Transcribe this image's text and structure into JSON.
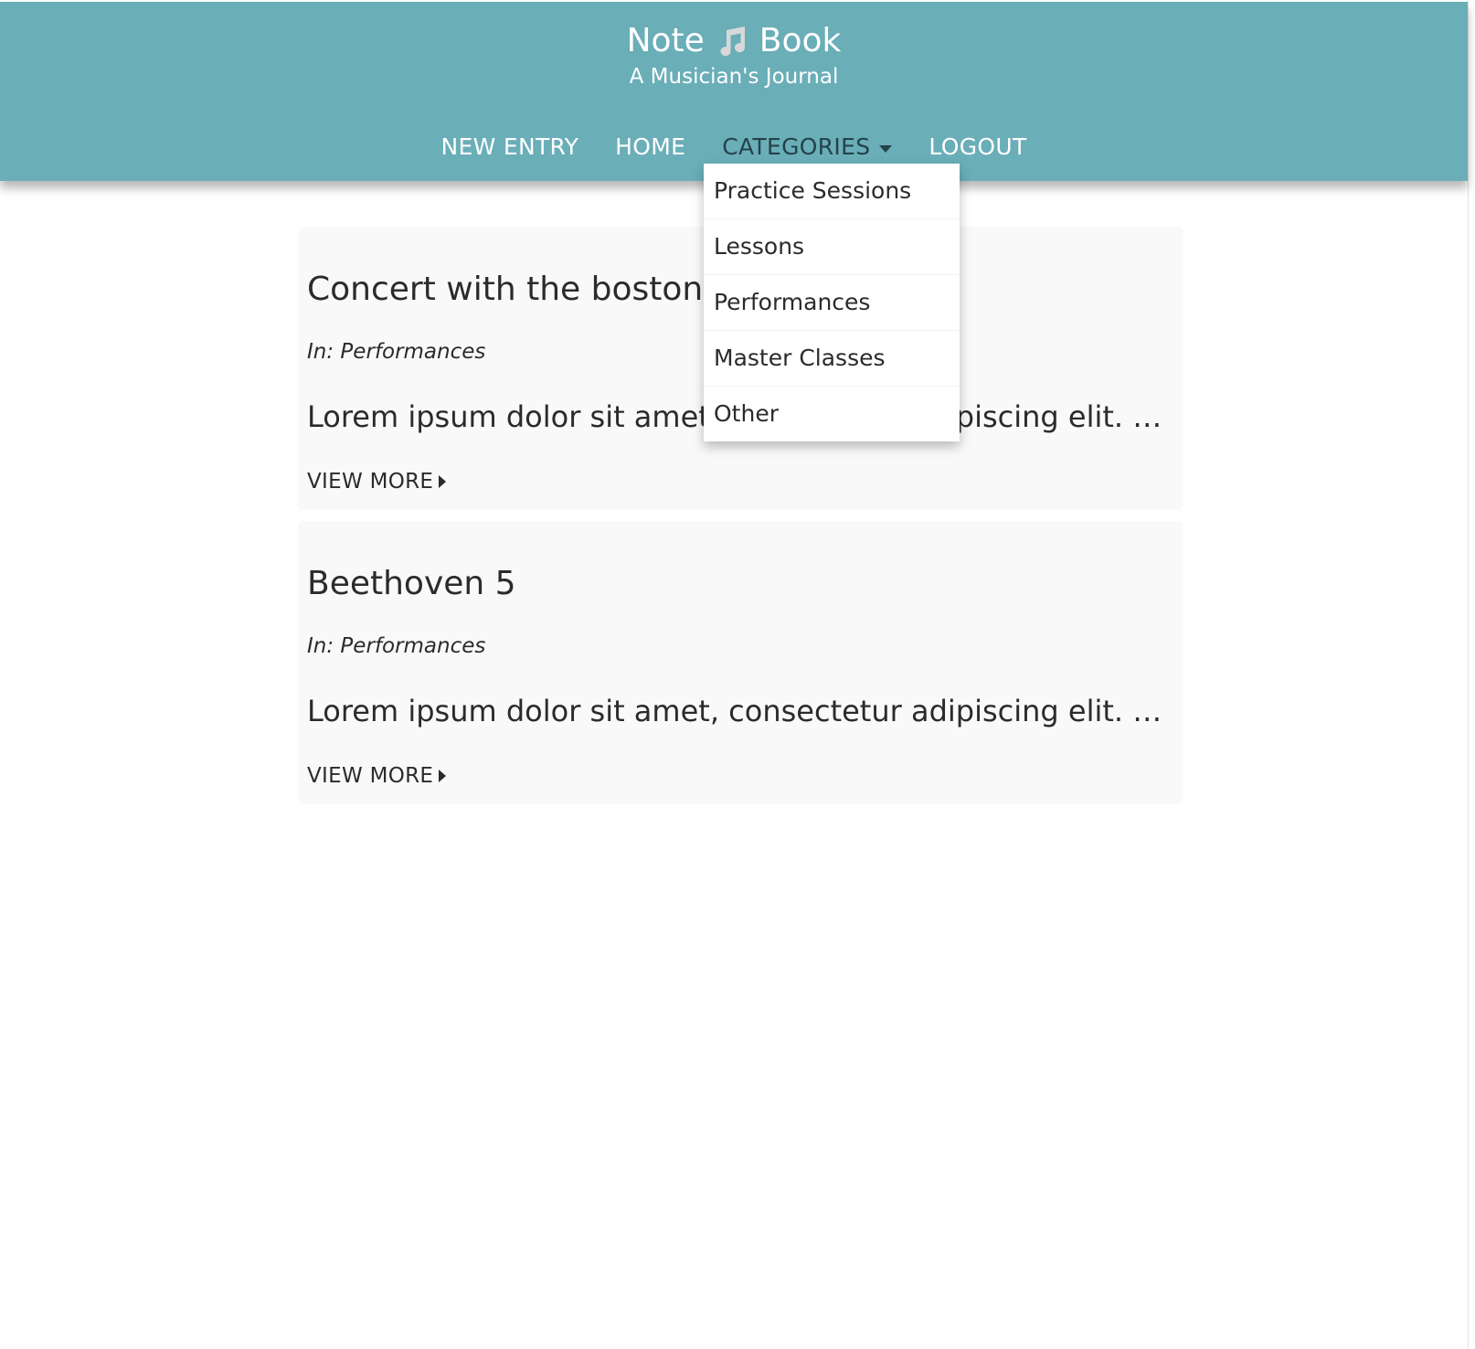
{
  "brand": {
    "title_left": "Note",
    "title_right": "Book",
    "logo_icon": "music-note-icon",
    "subtitle": "A Musician's Journal"
  },
  "colors": {
    "header_bg": "#6aaeb8",
    "header_text": "#ffffff",
    "active_nav": "#24434a",
    "card_bg": "#f9f9f9"
  },
  "nav": {
    "new_entry": "NEW ENTRY",
    "home": "HOME",
    "categories": "CATEGORIES",
    "logout": "LOGOUT"
  },
  "categories_menu": {
    "items": [
      "Practice Sessions",
      "Lessons",
      "Performances",
      "Master Classes",
      "Other"
    ]
  },
  "entries": [
    {
      "title": "Concert with the boston",
      "category": "In: Performances",
      "excerpt": "Lorem ipsum dolor sit amet, consectetur adipiscing elit. Praesent",
      "link": "VIEW MORE"
    },
    {
      "title": "Beethoven 5",
      "category": "In: Performances",
      "excerpt": "Lorem ipsum dolor sit amet, consectetur adipiscing elit. Praesent",
      "link": "VIEW MORE"
    }
  ]
}
